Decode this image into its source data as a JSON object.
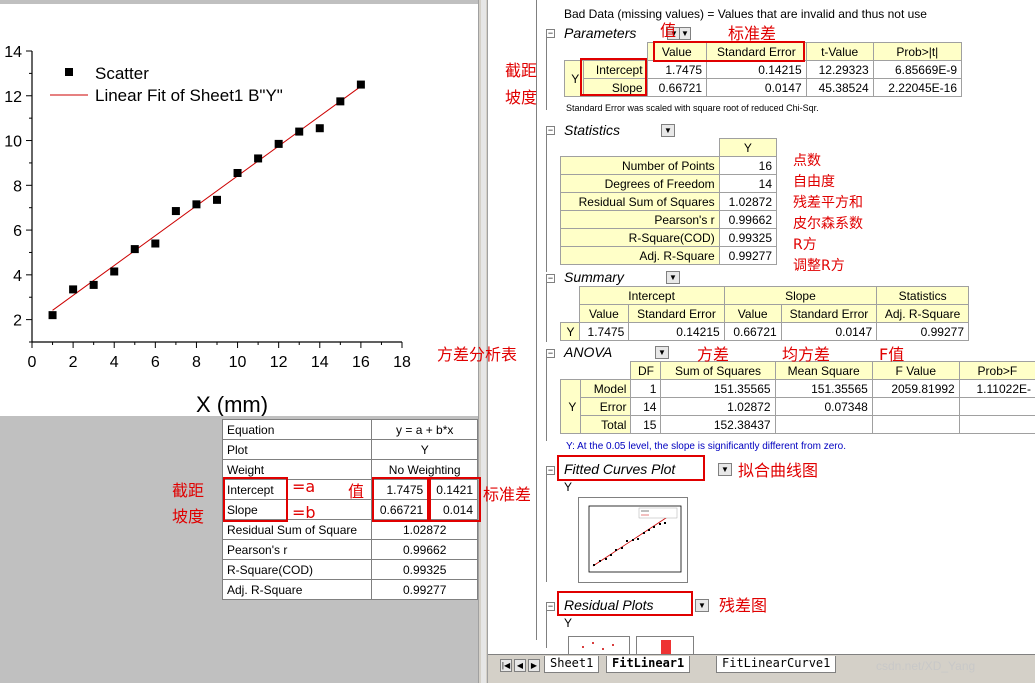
{
  "chart_data": {
    "type": "scatter",
    "xlabel": "X (mm)",
    "xlim": [
      0,
      18
    ],
    "ylim": [
      1,
      14
    ],
    "xticks": [
      "0",
      "2",
      "4",
      "6",
      "8",
      "10",
      "12",
      "14",
      "16",
      "18"
    ],
    "yticks": [
      "2",
      "4",
      "6",
      "8",
      "10",
      "12",
      "14"
    ],
    "series": [
      {
        "name": "Scatter",
        "kind": "points",
        "x": [
          1,
          2,
          3,
          4,
          5,
          6,
          7,
          8,
          9,
          10,
          11,
          12,
          13,
          14,
          15,
          16
        ],
        "y": [
          2.2,
          3.35,
          3.55,
          4.15,
          5.15,
          5.4,
          6.85,
          7.15,
          7.35,
          8.55,
          9.2,
          9.85,
          10.4,
          10.55,
          11.75,
          12.5
        ]
      },
      {
        "name": "Linear Fit of Sheet1 B\"Y\"",
        "kind": "line",
        "intercept": 1.7475,
        "slope": 0.66721,
        "x": [
          1,
          16
        ]
      }
    ],
    "legend": "top-left",
    "color_points": "#000000",
    "color_line": "#cc0000"
  },
  "fit_table": {
    "rows": [
      {
        "label": "Equation",
        "value": "y = a + b*x",
        "err": ""
      },
      {
        "label": "Plot",
        "value": "Y",
        "err": ""
      },
      {
        "label": "Weight",
        "value": "No Weighting",
        "err": ""
      },
      {
        "label": "Intercept",
        "value": "1.7475",
        "err": "0.1421"
      },
      {
        "label": "Slope",
        "value": "0.66721",
        "err": "0.014"
      },
      {
        "label": "Residual Sum of Square",
        "value": "1.02872",
        "err": ""
      },
      {
        "label": "Pearson's r",
        "value": "0.99662",
        "err": ""
      },
      {
        "label": "R-Square(COD)",
        "value": "0.99325",
        "err": ""
      },
      {
        "label": "Adj. R-Square",
        "value": "0.99277",
        "err": ""
      }
    ]
  },
  "report": {
    "top_cut_text": "Bad Data (missing values) = Values that are invalid and thus not use",
    "parameters": {
      "title": "Parameters",
      "headers": [
        "Value",
        "Standard Error",
        "t-Value",
        "Prob>|t|"
      ],
      "row_group": "Y",
      "rows": [
        {
          "name": "Intercept",
          "cells": [
            "1.7475",
            "0.14215",
            "12.29323",
            "6.85669E-9"
          ]
        },
        {
          "name": "Slope",
          "cells": [
            "0.66721",
            "0.0147",
            "45.38524",
            "2.22045E-16"
          ]
        }
      ],
      "note": "Standard Error was scaled with square root of reduced Chi-Sqr."
    },
    "statistics": {
      "title": "Statistics",
      "col": "Y",
      "rows": [
        {
          "label": "Number of Points",
          "value": "16"
        },
        {
          "label": "Degrees of Freedom",
          "value": "14"
        },
        {
          "label": "Residual Sum of Squares",
          "value": "1.02872"
        },
        {
          "label": "Pearson's r",
          "value": "0.99662"
        },
        {
          "label": "R-Square(COD)",
          "value": "0.99325"
        },
        {
          "label": "Adj. R-Square",
          "value": "0.99277"
        }
      ]
    },
    "summary": {
      "title": "Summary",
      "groups": [
        "Intercept",
        "Slope",
        "Statistics"
      ],
      "subheaders": [
        "Value",
        "Standard Error",
        "Value",
        "Standard Error",
        "Adj. R-Square"
      ],
      "row_label": "Y",
      "cells": [
        "1.7475",
        "0.14215",
        "0.66721",
        "0.0147",
        "0.99277"
      ]
    },
    "anova": {
      "title": "ANOVA",
      "headers": [
        "DF",
        "Sum of Squares",
        "Mean Square",
        "F Value",
        "Prob>F"
      ],
      "row_group": "Y",
      "rows": [
        {
          "name": "Model",
          "cells": [
            "1",
            "151.35565",
            "151.35565",
            "2059.81992",
            "1.11022E-"
          ]
        },
        {
          "name": "Error",
          "cells": [
            "14",
            "1.02872",
            "0.07348",
            "",
            ""
          ]
        },
        {
          "name": "Total",
          "cells": [
            "15",
            "152.38437",
            "",
            "",
            ""
          ]
        }
      ],
      "note": "Y: At the 0.05 level, the slope is significantly different from zero."
    },
    "fitted_curves": {
      "title": "Fitted Curves Plot",
      "col": "Y"
    },
    "residual_plots": {
      "title": "Residual Plots",
      "col": "Y"
    }
  },
  "tabs": {
    "items": [
      "Sheet1",
      "FitLinear1",
      "FitLinearCurve1"
    ],
    "active": "FitLinear1",
    "watermark": "csdn.net/XD_Yang"
  },
  "annotations": {
    "value": "值",
    "std_error": "标准差",
    "intercept": "截距",
    "slope": "坡度",
    "num_points": "点数",
    "dof": "自由度",
    "rss": "残差平方和",
    "pearson": "皮尔森系数",
    "r2": "R方",
    "adj_r2": "调整R方",
    "anova": "方差分析表",
    "variance": "方差",
    "mean_sq": "均方差",
    "f_value": "F值",
    "fitted_plot": "拟合曲线图",
    "residual_plot": "残差图",
    "eq_a": "=a",
    "eq_b": "=b",
    "colors": {
      "annotation": "#e00000",
      "header_fill": "#ffffc8"
    }
  }
}
